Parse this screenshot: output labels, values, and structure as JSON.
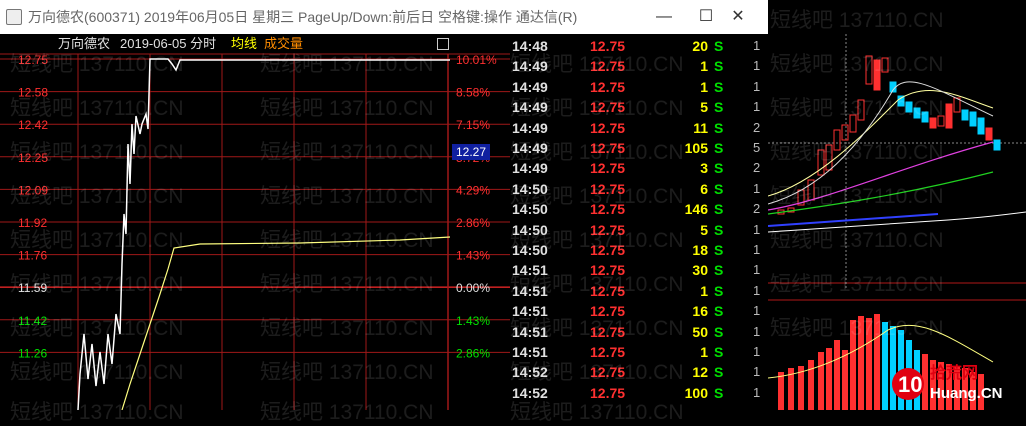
{
  "window": {
    "title": "万向德农(600371) 2019年06月05日 星期三 PageUp/Down:前后日 空格键:操作 通达信(R)",
    "minimize": "—",
    "maximize": "☐",
    "close": "✕"
  },
  "header": {
    "stock_name": "万向德农",
    "date_label": "2019-06-05 分时",
    "avg_label": "均线",
    "volume_label": "成交量"
  },
  "price_axis": [
    "12.75",
    "12.58",
    "12.42",
    "12.25",
    "12.09",
    "11.92",
    "11.76",
    "11.59",
    "11.42",
    "11.26"
  ],
  "pct_axis": [
    "10.01%",
    "8.58%",
    "7.15%",
    "5.72%",
    "4.29%",
    "2.86%",
    "1.43%",
    "0.00%",
    "1.43%",
    "2.86%"
  ],
  "crosshair_value": "12.27",
  "trades": [
    {
      "time": "14:48",
      "price": "12.75",
      "vol": "20",
      "side": "S",
      "count": "1"
    },
    {
      "time": "14:49",
      "price": "12.75",
      "vol": "1",
      "side": "S",
      "count": "1"
    },
    {
      "time": "14:49",
      "price": "12.75",
      "vol": "1",
      "side": "S",
      "count": "1"
    },
    {
      "time": "14:49",
      "price": "12.75",
      "vol": "5",
      "side": "S",
      "count": "1"
    },
    {
      "time": "14:49",
      "price": "12.75",
      "vol": "11",
      "side": "S",
      "count": "2"
    },
    {
      "time": "14:49",
      "price": "12.75",
      "vol": "105",
      "side": "S",
      "count": "5"
    },
    {
      "time": "14:49",
      "price": "12.75",
      "vol": "3",
      "side": "S",
      "count": "2"
    },
    {
      "time": "14:50",
      "price": "12.75",
      "vol": "6",
      "side": "S",
      "count": "1"
    },
    {
      "time": "14:50",
      "price": "12.75",
      "vol": "146",
      "side": "S",
      "count": "2"
    },
    {
      "time": "14:50",
      "price": "12.75",
      "vol": "5",
      "side": "S",
      "count": "1"
    },
    {
      "time": "14:50",
      "price": "12.75",
      "vol": "18",
      "side": "S",
      "count": "1"
    },
    {
      "time": "14:51",
      "price": "12.75",
      "vol": "30",
      "side": "S",
      "count": "1"
    },
    {
      "time": "14:51",
      "price": "12.75",
      "vol": "1",
      "side": "S",
      "count": "1"
    },
    {
      "time": "14:51",
      "price": "12.75",
      "vol": "16",
      "side": "S",
      "count": "1"
    },
    {
      "time": "14:51",
      "price": "12.75",
      "vol": "50",
      "side": "S",
      "count": "1"
    },
    {
      "time": "14:51",
      "price": "12.75",
      "vol": "1",
      "side": "S",
      "count": "1"
    },
    {
      "time": "14:52",
      "price": "12.75",
      "vol": "12",
      "side": "S",
      "count": "1"
    },
    {
      "time": "14:52",
      "price": "12.75",
      "vol": "100",
      "side": "S",
      "count": "1"
    }
  ],
  "watermark": "短线吧 137110.CN",
  "logo": {
    "number": "10",
    "name": "拾荒网",
    "url": "Huang.CN"
  },
  "colors": {
    "up": "#ff3030",
    "down": "#00e000",
    "neutral": "#e0e0e0",
    "avg": "#ffff80",
    "grid": "#b01818",
    "badge": "#1020a0"
  }
}
